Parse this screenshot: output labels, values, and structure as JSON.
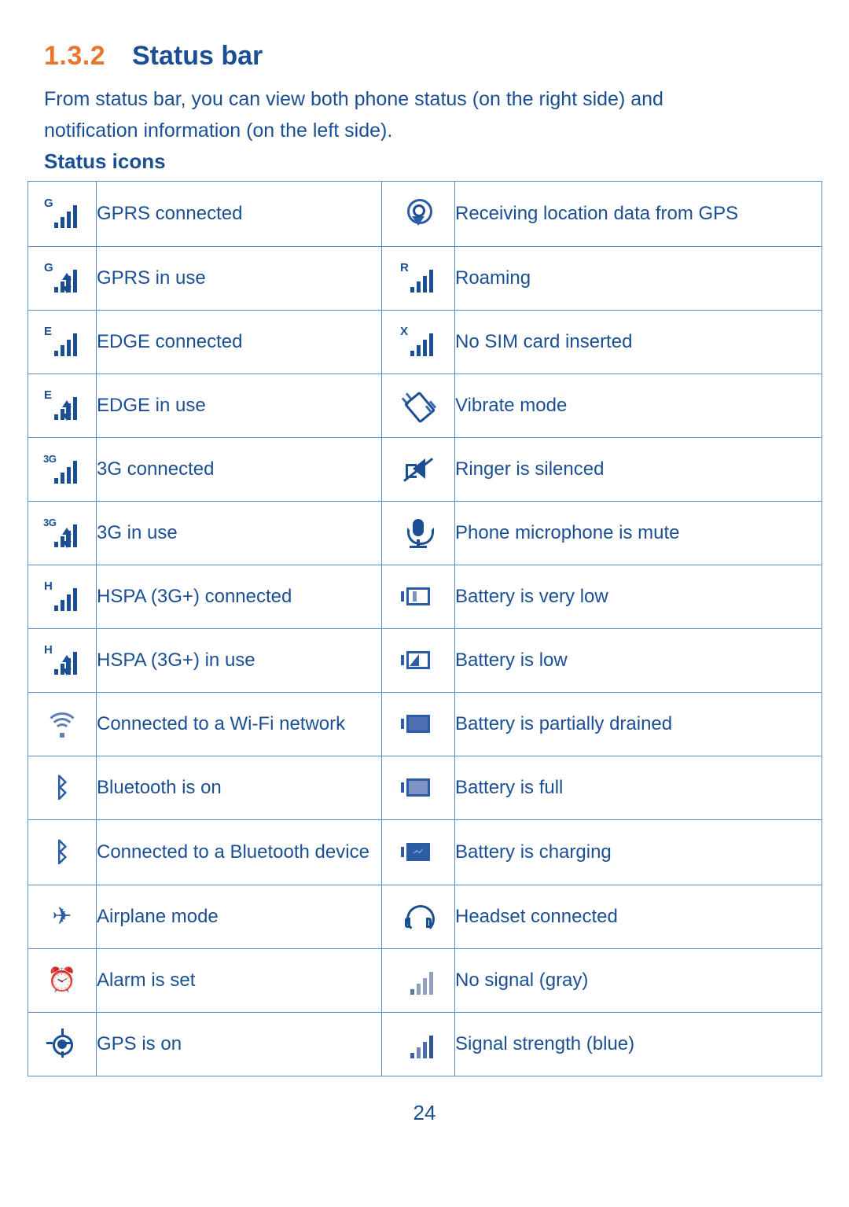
{
  "heading": {
    "number": "1.3.2",
    "title": "Status bar"
  },
  "intro": {
    "line1": "From status bar, you can view both phone status (on the right side) and",
    "line2": "notification information (on the left side)."
  },
  "subheading": "Status icons",
  "table": {
    "rows": [
      {
        "left_icon": "gprs-connected-icon",
        "left_text": "GPRS connected",
        "right_icon": "receiving-location-data-icon",
        "right_text": "Receiving location data from GPS"
      },
      {
        "left_icon": "gprs-in-use-icon",
        "left_text": "GPRS in use",
        "right_icon": "roaming-icon",
        "right_text": "Roaming"
      },
      {
        "left_icon": "edge-connected-icon",
        "left_text": "EDGE connected",
        "right_icon": "no-sim-card-icon",
        "right_text": "No SIM card inserted"
      },
      {
        "left_icon": "edge-in-use-icon",
        "left_text": "EDGE in use",
        "right_icon": "vibrate-mode-icon",
        "right_text": "Vibrate mode"
      },
      {
        "left_icon": "3g-connected-icon",
        "left_text": "3G connected",
        "right_icon": "ringer-silenced-icon",
        "right_text": "Ringer is silenced"
      },
      {
        "left_icon": "3g-in-use-icon",
        "left_text": "3G in use",
        "right_icon": "microphone-mute-icon",
        "right_text": "Phone microphone is mute"
      },
      {
        "left_icon": "hspa-connected-icon",
        "left_text": "HSPA (3G+) connected",
        "right_icon": "battery-very-low-icon",
        "right_text": "Battery is very low"
      },
      {
        "left_icon": "hspa-in-use-icon",
        "left_text": "HSPA (3G+) in use",
        "right_icon": "battery-low-icon",
        "right_text": "Battery is low"
      },
      {
        "left_icon": "wifi-connected-icon",
        "left_text": "Connected to a Wi-Fi network",
        "right_icon": "battery-partially-drained-icon",
        "right_text": "Battery is partially drained"
      },
      {
        "left_icon": "bluetooth-on-icon",
        "left_text": "Bluetooth is on",
        "right_icon": "battery-full-icon",
        "right_text": "Battery is full"
      },
      {
        "left_icon": "bluetooth-connected-icon",
        "left_text": "Connected to a Bluetooth device",
        "right_icon": "battery-charging-icon",
        "right_text": "Battery is charging"
      },
      {
        "left_icon": "airplane-mode-icon",
        "left_text": "Airplane mode",
        "right_icon": "headset-connected-icon",
        "right_text": "Headset connected"
      },
      {
        "left_icon": "alarm-set-icon",
        "left_text": "Alarm is set",
        "right_icon": "no-signal-icon",
        "right_text": "No signal (gray)"
      },
      {
        "left_icon": "gps-on-icon",
        "left_text": "GPS is on",
        "right_icon": "signal-strength-icon",
        "right_text": "Signal strength (blue)"
      }
    ],
    "network_letters": {
      "gprs": "G",
      "edge": "E",
      "threeg": "3G",
      "hspa": "H",
      "roaming": "R",
      "nosim": "X"
    },
    "glyphs": {
      "bluetooth": "ᛒ",
      "airplane": "✈",
      "alarm": "⏰"
    }
  },
  "page_number": "24",
  "colors": {
    "text_blue": "#1b4f94",
    "accent_orange": "#e8762c",
    "border_blue": "#5f8fc4",
    "icon_light_blue": "#7f92c6"
  }
}
